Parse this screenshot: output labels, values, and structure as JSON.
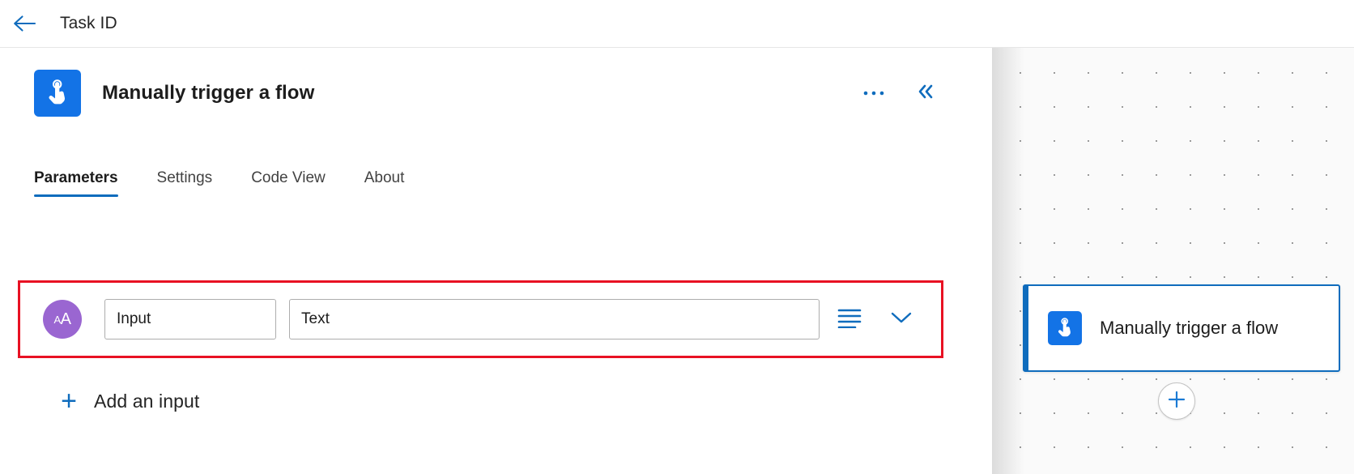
{
  "topbar": {
    "back_icon": "arrow-left-icon",
    "title": "Task ID"
  },
  "panel": {
    "icon": "manual-trigger-icon",
    "title": "Manually trigger a flow",
    "more_options_label": "•••",
    "more_options_icon": "ellipsis-icon",
    "collapse_icon": "double-chevron-left-icon",
    "tabs": [
      {
        "label": "Parameters",
        "active": true
      },
      {
        "label": "Settings",
        "active": false
      },
      {
        "label": "Code View",
        "active": false
      },
      {
        "label": "About",
        "active": false
      }
    ],
    "parameter_row": {
      "type_icon": "text-type-icon",
      "type_icon_small": "A",
      "type_icon_large": "A",
      "name_value": "Input",
      "name_placeholder": "Input",
      "type_value": "Text",
      "type_placeholder": "Text",
      "list_icon": "list-icon",
      "expand_icon": "chevron-down-icon",
      "highlight_color": "#e81123"
    },
    "add_input": {
      "icon": "plus-icon",
      "plus": "+",
      "label": "Add an input"
    }
  },
  "canvas": {
    "node": {
      "icon": "manual-trigger-icon",
      "title": "Manually trigger a flow",
      "selected": true,
      "accent_color": "#0f6cbd"
    },
    "add_node": {
      "icon": "plus-circle-icon",
      "label": "+"
    }
  },
  "colors": {
    "accent": "#0f6cbd",
    "trigger_blue": "#1373e6",
    "type_purple": "#9a66d1",
    "highlight_red": "#e81123"
  }
}
